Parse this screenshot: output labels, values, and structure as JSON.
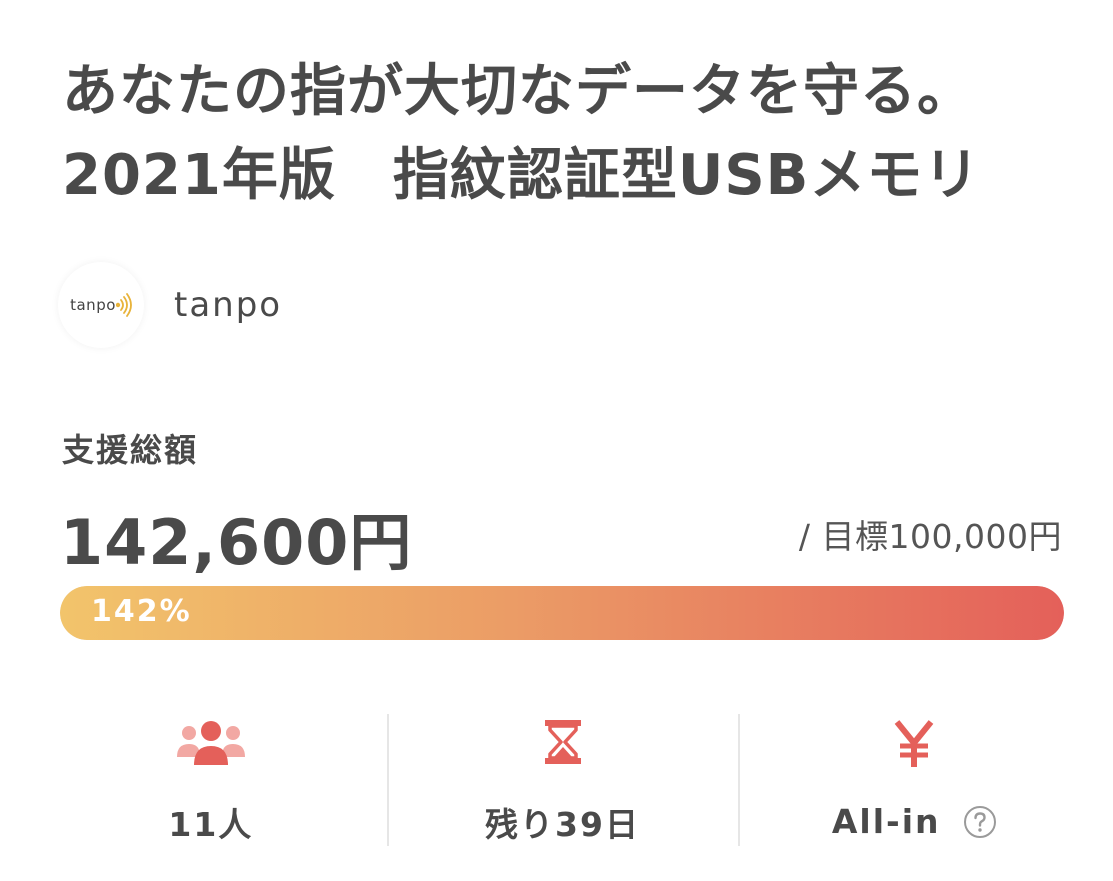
{
  "project": {
    "title_line1": "あなたの指が大切なデータを守る。",
    "title_line2": "2021年版　指紋認証型USBメモリ"
  },
  "owner": {
    "logo_text": "tanpo",
    "name": "tanpo",
    "accent_color": "#e8b33a"
  },
  "funding": {
    "label": "支援総額",
    "amount": "142,600円",
    "goal": "/ 目標100,000円",
    "progress_label": "142%",
    "progress_percent": 142,
    "gradient_colors": [
      "#f2c46b",
      "#eb9c66",
      "#e4605a"
    ]
  },
  "stats": {
    "supporters": {
      "icon": "people-icon",
      "value": "11人"
    },
    "remaining": {
      "icon": "hourglass-icon",
      "value": "残り39日"
    },
    "type": {
      "icon": "yen-icon",
      "value": "All-in",
      "help_icon": "question-circle-icon"
    },
    "icon_color": "#e4605a"
  }
}
